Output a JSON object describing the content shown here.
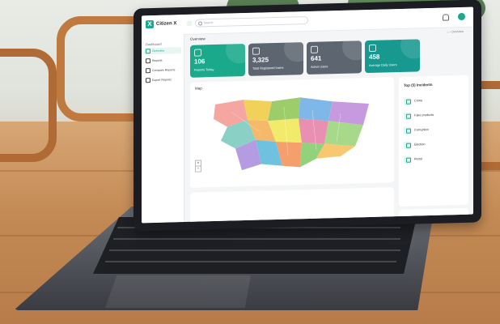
{
  "app": {
    "name": "Citizen X",
    "logo_letter": "X"
  },
  "sidebar": {
    "section": "Dashboard",
    "items": [
      {
        "label": "Overview",
        "active": true
      },
      {
        "label": "Reports",
        "active": false
      },
      {
        "label": "Compare Reports",
        "active": false
      },
      {
        "label": "Export Reports",
        "active": false
      }
    ]
  },
  "topbar": {
    "search_placeholder": "Search"
  },
  "page": {
    "title": "Overview",
    "breadcrumb": "Overview"
  },
  "cards": [
    {
      "value": "106",
      "label": "Reports Today",
      "color": "#1aa98a"
    },
    {
      "value": "3,325",
      "label": "Total Registered Users",
      "color": "#5d6670"
    },
    {
      "value": "641",
      "label": "Active Users",
      "color": "#5d6670"
    },
    {
      "value": "458",
      "label": "Average Daily Users",
      "color": "#17998f"
    }
  ],
  "map": {
    "title": "Map",
    "zoom_in": "+",
    "zoom_out": "−"
  },
  "incidents": {
    "title": "Top (5) Incidents",
    "items": [
      "Crime",
      "Fake products",
      "Corruption",
      "Election",
      "Petrol"
    ]
  },
  "colors": {
    "accent": "#1aa98a",
    "card_gray": "#5d6670"
  }
}
